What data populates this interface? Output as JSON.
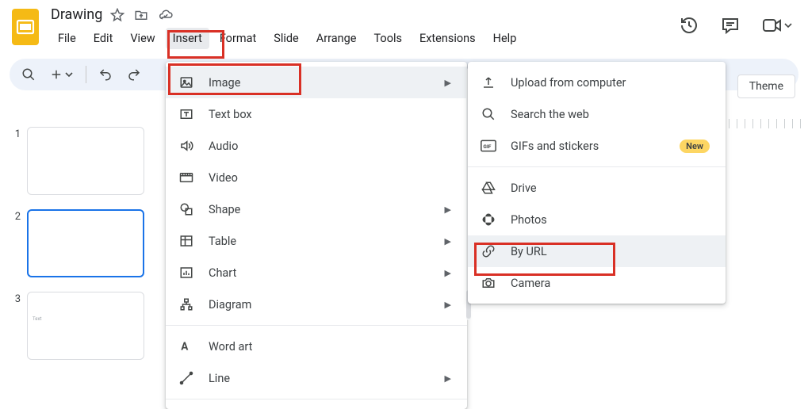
{
  "doc": {
    "title": "Drawing"
  },
  "menus": {
    "file": "File",
    "edit": "Edit",
    "view": "View",
    "insert": "Insert",
    "format": "Format",
    "slide": "Slide",
    "arrange": "Arrange",
    "tools": "Tools",
    "extensions": "Extensions",
    "help": "Help"
  },
  "toolbar": {
    "theme": "Theme"
  },
  "slides": {
    "n1": "1",
    "n2": "2",
    "n3": "3",
    "thumb3_text": "Text"
  },
  "insert_menu": {
    "image": "Image",
    "textbox": "Text box",
    "audio": "Audio",
    "video": "Video",
    "shape": "Shape",
    "table": "Table",
    "chart": "Chart",
    "diagram": "Diagram",
    "wordart": "Word art",
    "line": "Line"
  },
  "image_submenu": {
    "upload": "Upload from computer",
    "search": "Search the web",
    "gifs": "GIFs and stickers",
    "gifs_badge": "New",
    "drive": "Drive",
    "photos": "Photos",
    "byurl": "By URL",
    "camera": "Camera"
  }
}
